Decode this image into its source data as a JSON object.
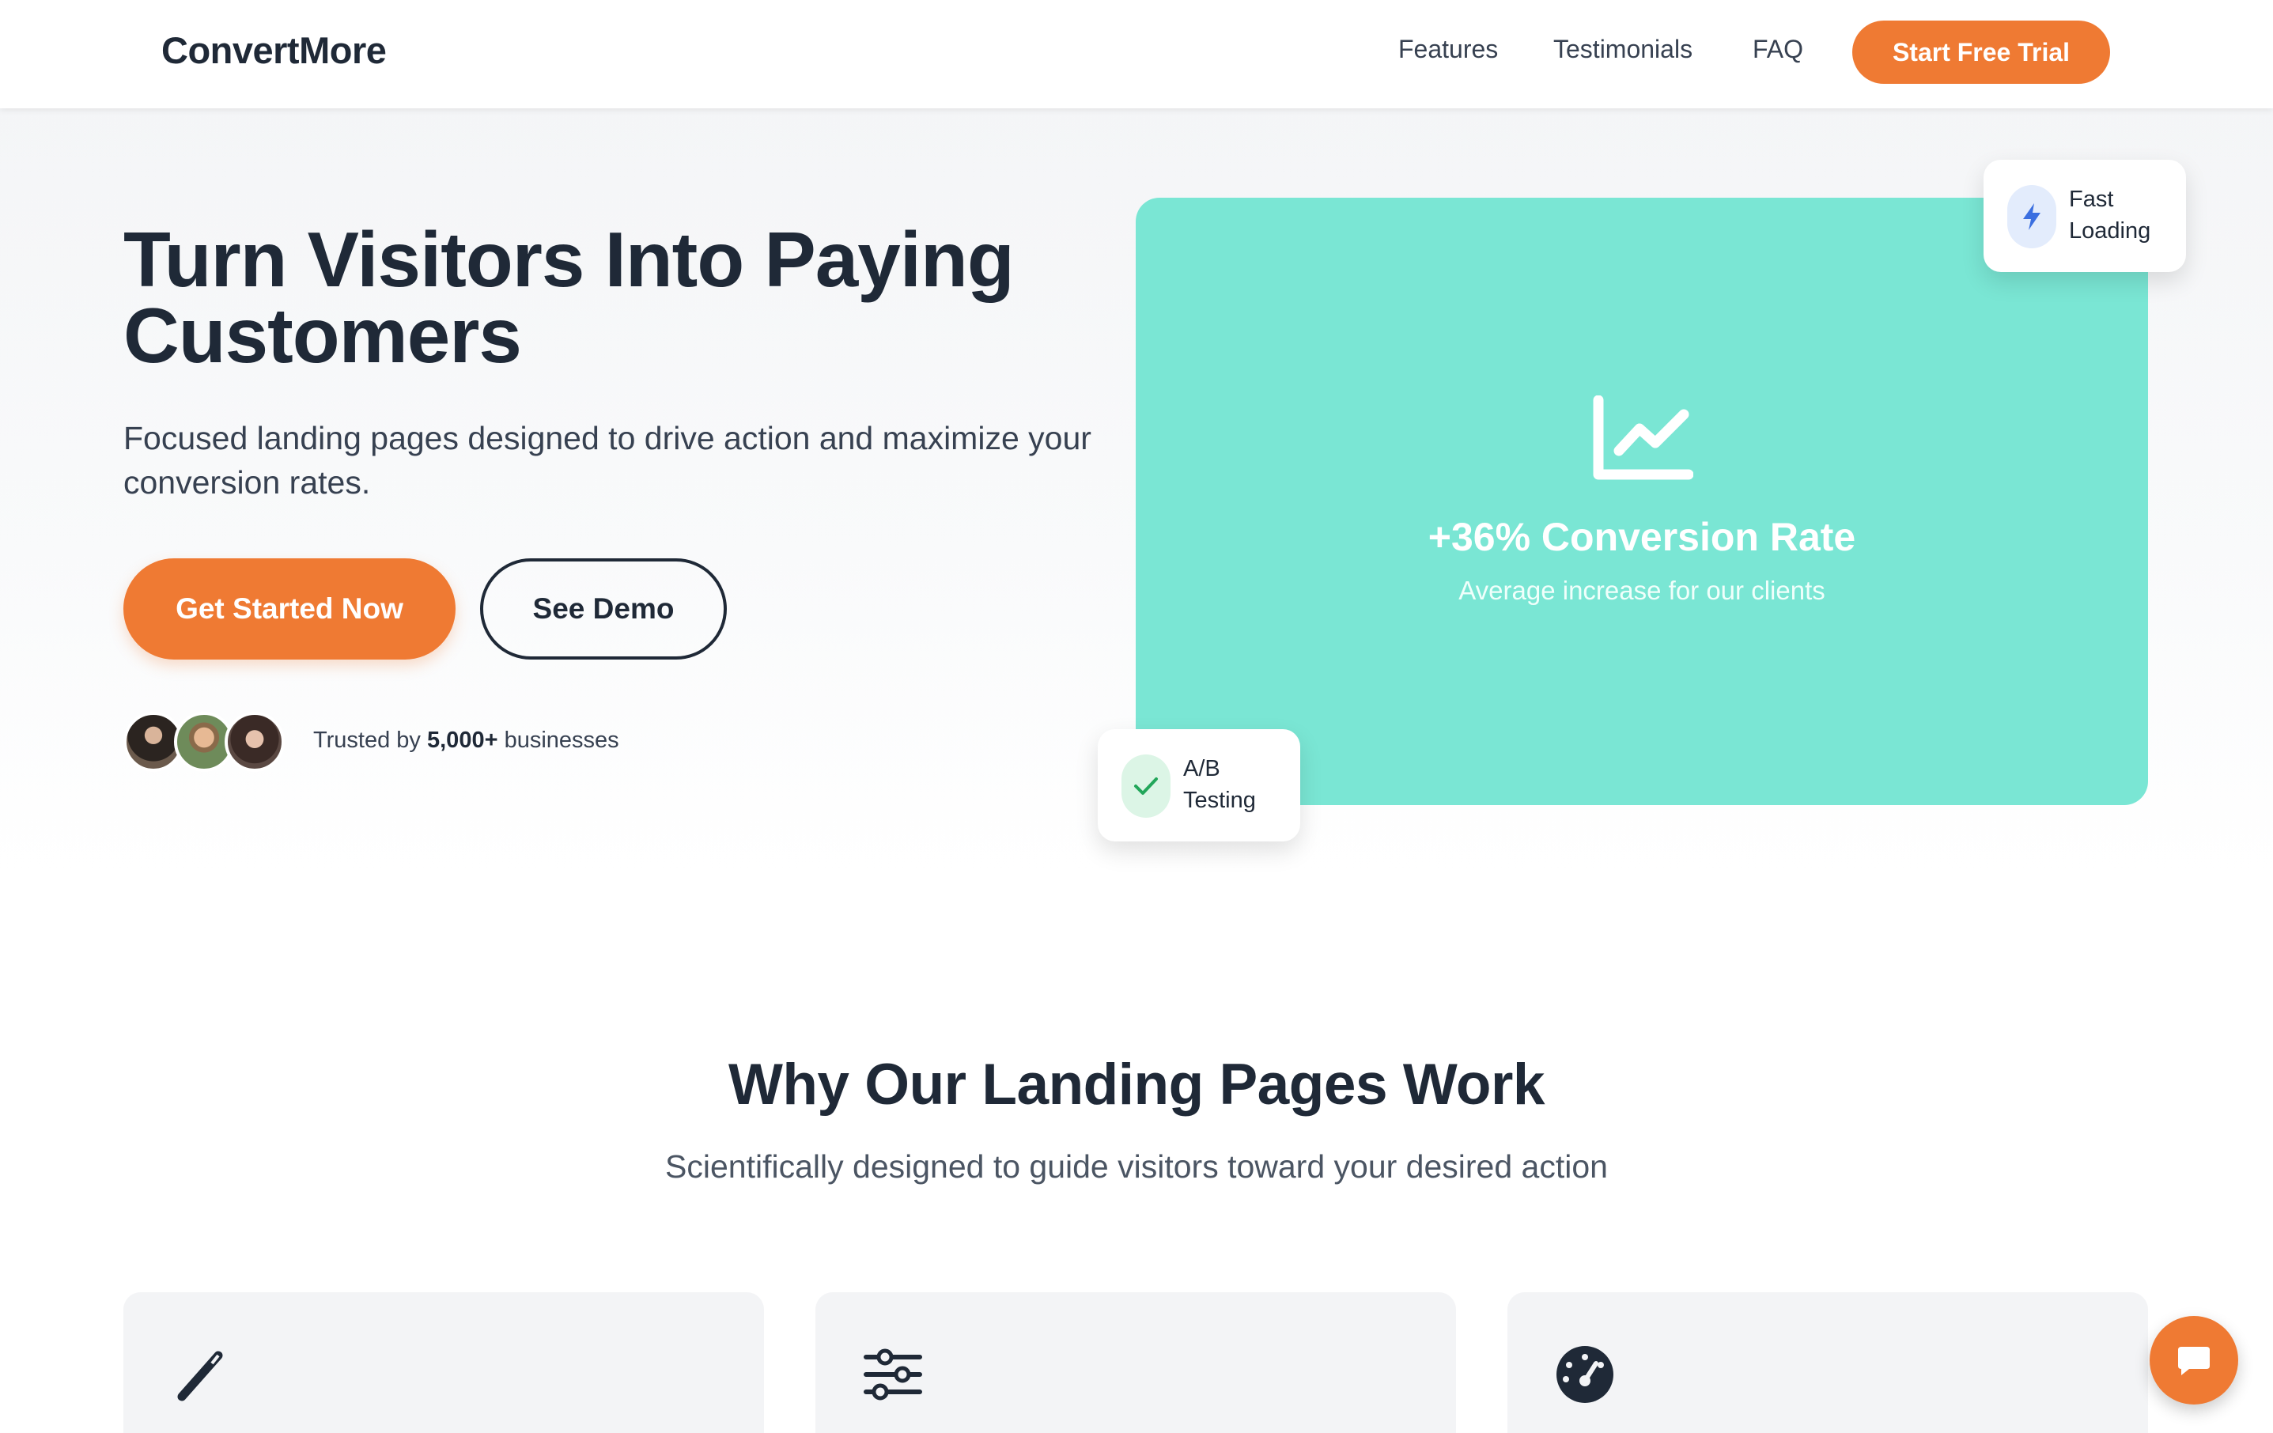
{
  "nav": {
    "logo": "ConvertMore",
    "links": [
      "Features",
      "Testimonials",
      "FAQ"
    ],
    "cta": "Start Free Trial"
  },
  "hero": {
    "title": "Turn Visitors Into Paying Customers",
    "subtitle": "Focused landing pages designed to drive action and maximize your conversion rates.",
    "primary_cta": "Get Started Now",
    "secondary_cta": "See Demo",
    "trust_prefix": "Trusted by",
    "trust_count": "5,000+",
    "trust_suffix": "businesses"
  },
  "stat_card": {
    "icon": "chart-line-icon",
    "value": "+36% Conversion Rate",
    "caption": "Average increase for our clients"
  },
  "badges": {
    "fast_loading": {
      "icon": "bolt-icon",
      "line1": "Fast",
      "line2": "Loading"
    },
    "ab_testing": {
      "icon": "check-icon",
      "line1": "A/B",
      "line2": "Testing"
    }
  },
  "section": {
    "title": "Why Our Landing Pages Work",
    "subtitle": "Scientifically designed to guide visitors toward your desired action"
  },
  "features": [
    {
      "icon": "magic-wand-icon"
    },
    {
      "icon": "sliders-icon"
    },
    {
      "icon": "speedometer-icon"
    }
  ],
  "colors": {
    "accent": "#ef7a33",
    "card": "#7ae6d4",
    "text": "#1f2937"
  }
}
